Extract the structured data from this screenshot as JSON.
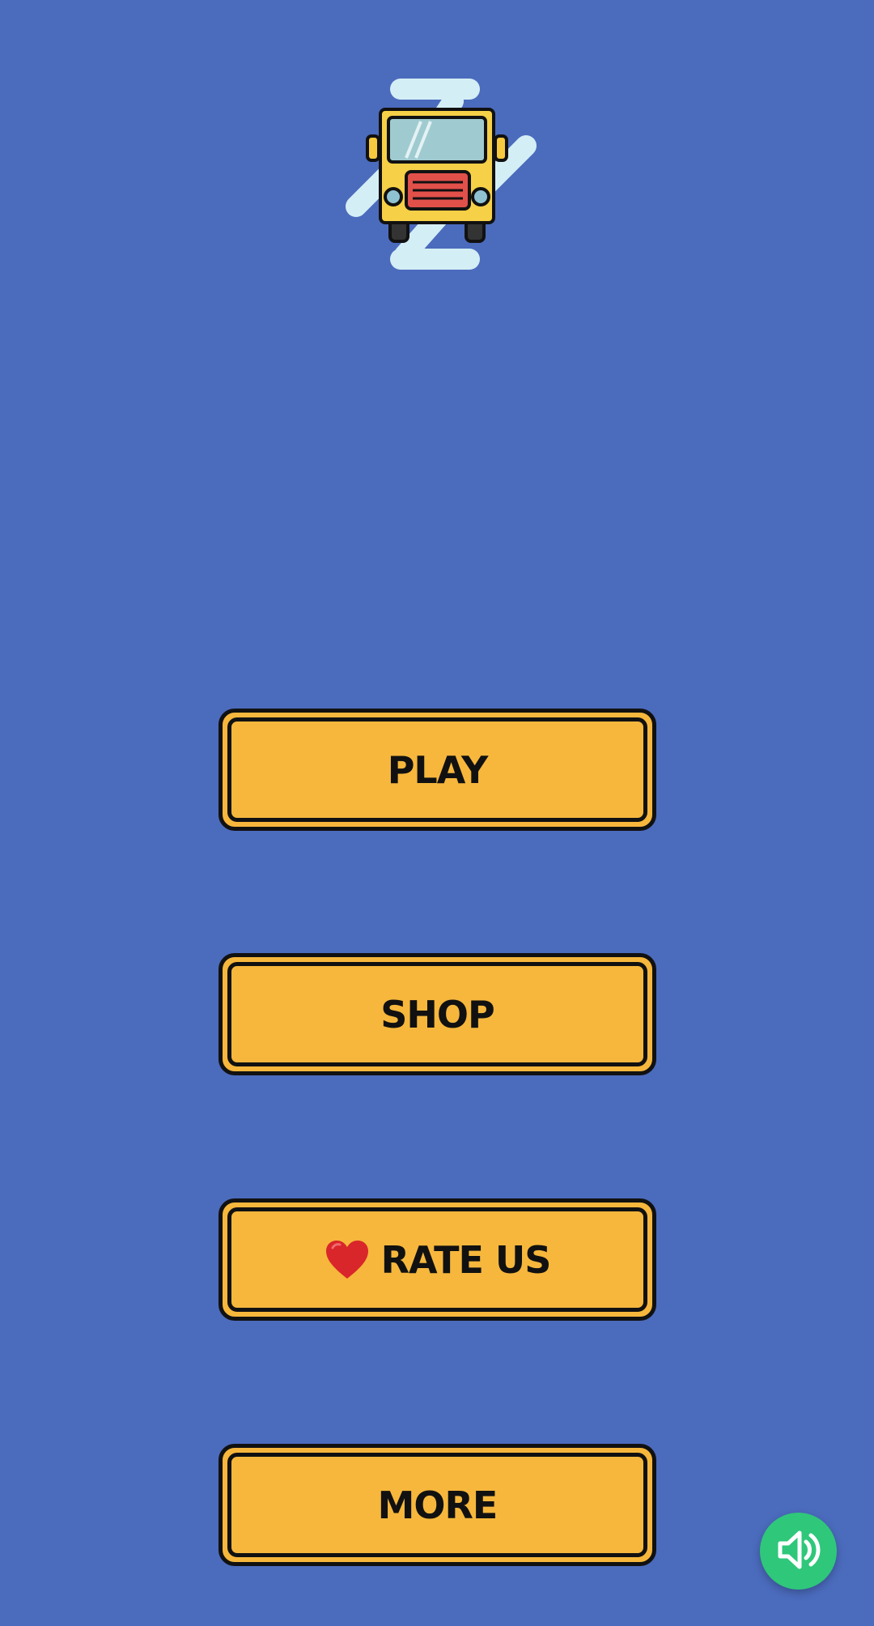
{
  "menu": {
    "play_label": "PLAY",
    "shop_label": "SHOP",
    "rate_label": "RATE US",
    "more_label": "MORE"
  },
  "icons": {
    "logo": "bus-icon",
    "rate": "heart-icon",
    "sound": "speaker-icon"
  },
  "colors": {
    "background": "#4b6bbd",
    "button_fill": "#f6b73c",
    "button_border": "#111111",
    "sound_button": "#2fc77a"
  }
}
